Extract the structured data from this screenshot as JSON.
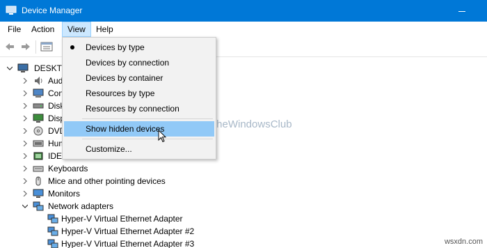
{
  "window": {
    "title": "Device Manager"
  },
  "menubar": {
    "items": [
      "File",
      "Action",
      "View",
      "Help"
    ],
    "active": "View"
  },
  "tree": {
    "root": "DESKTOP",
    "categories": [
      {
        "label": "Aud",
        "icon": "speaker-icon"
      },
      {
        "label": "Con",
        "icon": "computer-icon"
      },
      {
        "label": "Disk",
        "icon": "disk-drive-icon"
      },
      {
        "label": "Disp",
        "icon": "display-adapter-icon"
      },
      {
        "label": "DVD",
        "icon": "dvd-icon"
      },
      {
        "label": "Hum",
        "icon": "hid-icon"
      },
      {
        "label": "IDE",
        "icon": "ide-controller-icon"
      },
      {
        "label": "Keyboards",
        "icon": "keyboard-icon"
      },
      {
        "label": "Mice and other pointing devices",
        "icon": "mouse-icon"
      },
      {
        "label": "Monitors",
        "icon": "monitor-icon"
      },
      {
        "label": "Network adapters",
        "icon": "network-adapter-icon"
      }
    ],
    "network_children": [
      "Hyper-V Virtual Ethernet Adapter",
      "Hyper-V Virtual Ethernet Adapter #2",
      "Hyper-V Virtual Ethernet Adapter #3"
    ]
  },
  "view_menu": {
    "items": [
      {
        "label": "Devices by type",
        "checked": true
      },
      {
        "label": "Devices by connection",
        "checked": false
      },
      {
        "label": "Devices by container",
        "checked": false
      },
      {
        "label": "Resources by type",
        "checked": false
      },
      {
        "label": "Resources by connection",
        "checked": false
      },
      {
        "label": "Show hidden devices",
        "checked": false,
        "highlighted": true
      },
      {
        "label": "Customize...",
        "checked": false
      }
    ]
  },
  "watermark": {
    "text": "TheWindowsClub"
  },
  "footer": {
    "site": "wsxdn.com"
  },
  "colors": {
    "titlebar": "#0078d7",
    "menu_hover": "#91c9f7",
    "menu_active": "#cce8ff"
  }
}
